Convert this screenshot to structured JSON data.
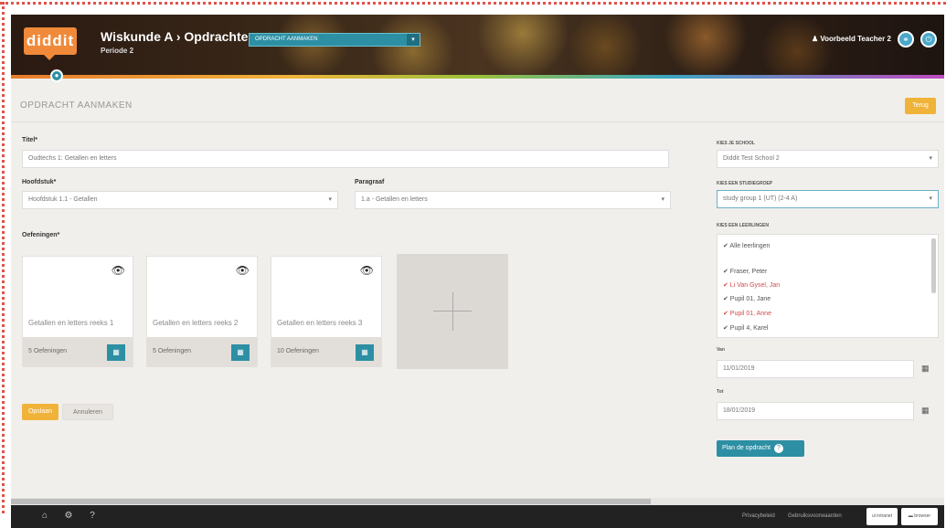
{
  "header": {
    "logo": "diddit",
    "breadcrumb": "Wiskunde A › Opdrachten ›",
    "subtitle": "Periode 2",
    "select_value": "OPDRACHT AANMAKEN",
    "user": "♟ Voorbeeld Teacher 2"
  },
  "page": {
    "title": "OPDRACHT AANMAKEN",
    "back_label": "Terug"
  },
  "form": {
    "title_label": "Titel*",
    "title_value": "Oudtechs 1: Getallen en letters",
    "chapter_label": "Hoofdstuk*",
    "chapter_value": "Hoofdstuk 1.1 - Getallen",
    "paragraph_label": "Paragraaf",
    "paragraph_value": "1.a - Getallen en letters",
    "exercises_label": "Oefeningen*"
  },
  "cards": [
    {
      "title": "Getallen en letters reeks 1",
      "count": "5 Oefeningen"
    },
    {
      "title": "Getallen en letters reeks 2",
      "count": "5 Oefeningen"
    },
    {
      "title": "Getallen en letters reeks 3",
      "count": "10 Oefeningen"
    }
  ],
  "buttons": {
    "save": "Opslaan",
    "cancel": "Annuleren",
    "plan": "Plan de opdracht"
  },
  "sidebar": {
    "school_label": "KIES JE SCHOOL",
    "school_value": "Diddit Test School 2",
    "group_label": "KIES EEN STUDIEGROEP",
    "group_value": "study group 1 (UT) (2-4 A)",
    "students_label": "KIES EEN LEERLINGEN",
    "students": [
      {
        "name": "✔ Alle leerlingen",
        "red": false
      },
      {
        "name": "✔ Fraser, Peter",
        "red": false
      },
      {
        "name": "✔ Li Van Gysel, Jan",
        "red": true
      },
      {
        "name": "✔ Pupil 01, Jane",
        "red": false
      },
      {
        "name": "✔ Pupil 01, Anne",
        "red": true
      },
      {
        "name": "✔ Pupil 4, Karel",
        "red": false
      }
    ],
    "from_label": "Van",
    "from_value": "11/01/2019",
    "to_label": "Tot",
    "to_value": "18/01/2019"
  },
  "footer": {
    "privacy": "Privacybeleid",
    "terms": "Gebruiksvoorwaarden",
    "btn1": "ui intranet",
    "btn2": "▬ browser"
  }
}
